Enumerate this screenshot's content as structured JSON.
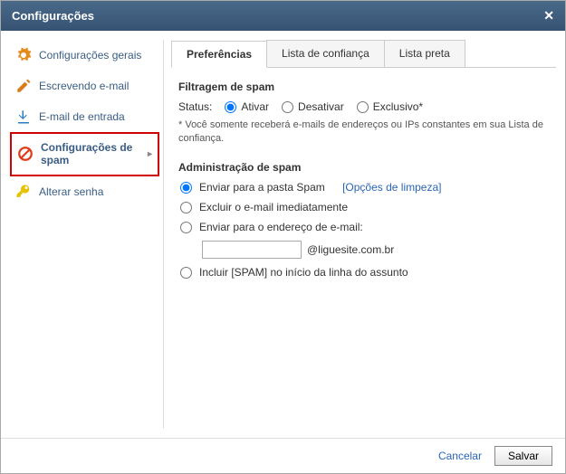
{
  "dialog": {
    "title": "Configurações"
  },
  "sidebar": {
    "items": [
      {
        "label": "Configurações gerais"
      },
      {
        "label": "Escrevendo e-mail"
      },
      {
        "label": "E-mail de entrada"
      },
      {
        "label": "Configurações de spam"
      },
      {
        "label": "Alterar senha"
      }
    ]
  },
  "tabs": {
    "preferences": "Preferências",
    "trustlist": "Lista de confiança",
    "blacklist": "Lista preta"
  },
  "spam": {
    "filter_title": "Filtragem de spam",
    "status_label": "Status:",
    "status_options": {
      "activate": "Ativar",
      "deactivate": "Desativar",
      "exclusive": "Exclusivo*"
    },
    "status_note": "* Você somente receberá e-mails de endereços ou IPs constantes em sua Lista de confiança.",
    "admin_title": "Administração de spam",
    "admin_options": {
      "send_folder": "Enviar para a pasta Spam",
      "cleanup_link": "[Opções de limpeza]",
      "delete_now": "Excluir o e-mail imediatamente",
      "forward_to": "Enviar para o endereço de e-mail:",
      "forward_domain": "@liguesite.com.br",
      "tag_subject": "Incluir [SPAM] no início da linha do assunto"
    }
  },
  "footer": {
    "cancel": "Cancelar",
    "save": "Salvar"
  }
}
